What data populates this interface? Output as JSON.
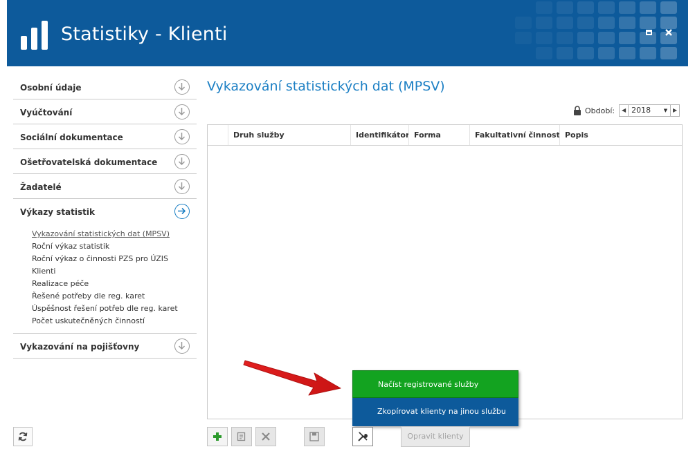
{
  "window": {
    "title": "Statistiky - Klienti",
    "colors": {
      "header_bg": "#0d5a9b",
      "accent": "#1b7fc4",
      "highlight": "#13a320"
    }
  },
  "sidebar": {
    "items": [
      {
        "label": "Osobní údaje",
        "icon": "arrow-down-circle-icon"
      },
      {
        "label": "Vyúčtování",
        "icon": "arrow-down-circle-icon"
      },
      {
        "label": "Sociální dokumentace",
        "icon": "arrow-down-circle-icon"
      },
      {
        "label": "Ošetřovatelská dokumentace",
        "icon": "arrow-down-circle-icon"
      },
      {
        "label": "Žadatelé",
        "icon": "arrow-down-circle-icon"
      },
      {
        "label": "Výkazy statistik",
        "icon": "arrow-right-circle-icon"
      },
      {
        "label": "Vykazování na pojišťovny",
        "icon": "arrow-down-circle-icon"
      }
    ],
    "subitems": [
      "Vykazování statistických dat (MPSV)",
      "Roční výkaz statistik",
      "Roční výkaz o činnosti PZS pro ÚZIS",
      "Klienti",
      "Realizace péče",
      "Řešené potřeby dle reg. karet",
      "Úspěšnost řešení potřeb dle reg. karet",
      "Počet uskutečněných činností"
    ]
  },
  "main": {
    "title": "Vykazování statistických dat (MPSV)",
    "period_label": "Období:",
    "period_value": "2018",
    "columns": [
      "Druh služby",
      "Identifikátor",
      "Forma",
      "Fakultativní činnosti",
      "Popis"
    ]
  },
  "popup_menu": {
    "items": [
      "Načíst registrované služby",
      "Zkopírovat klienty na jinou službu"
    ]
  },
  "toolbar": {
    "fix_clients_label": "Opravit klienty"
  }
}
